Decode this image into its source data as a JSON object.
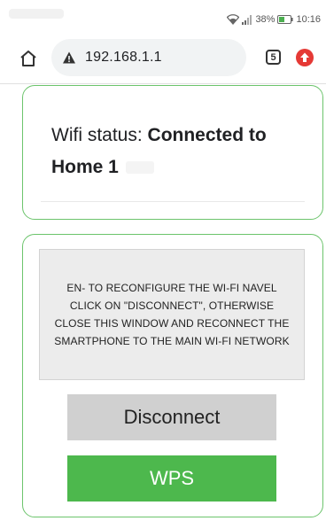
{
  "status_bar": {
    "battery": "38%",
    "time": "10:16"
  },
  "browser": {
    "url": "192.168.1.1",
    "tab_count": "5",
    "icons": {
      "home": "home-icon",
      "warning": "warning-icon",
      "upload": "upload-icon"
    }
  },
  "wifi_status": {
    "label": "Wifi status: ",
    "value": "Connected to Home 1"
  },
  "notice": {
    "text": "EN- TO RECONFIGURE THE WI-FI NAVEL CLICK ON \"DISCONNECT\", OTHERWISE CLOSE THIS WINDOW AND RECONNECT THE SMARTPHONE TO THE MAIN WI-FI NETWORK"
  },
  "buttons": {
    "disconnect": "Disconnect",
    "wps": "WPS"
  },
  "colors": {
    "card_border": "#6cc46c",
    "wps_button": "#4db84d",
    "disconnect_button": "#d0d0d0",
    "upload_icon": "#e53935"
  }
}
